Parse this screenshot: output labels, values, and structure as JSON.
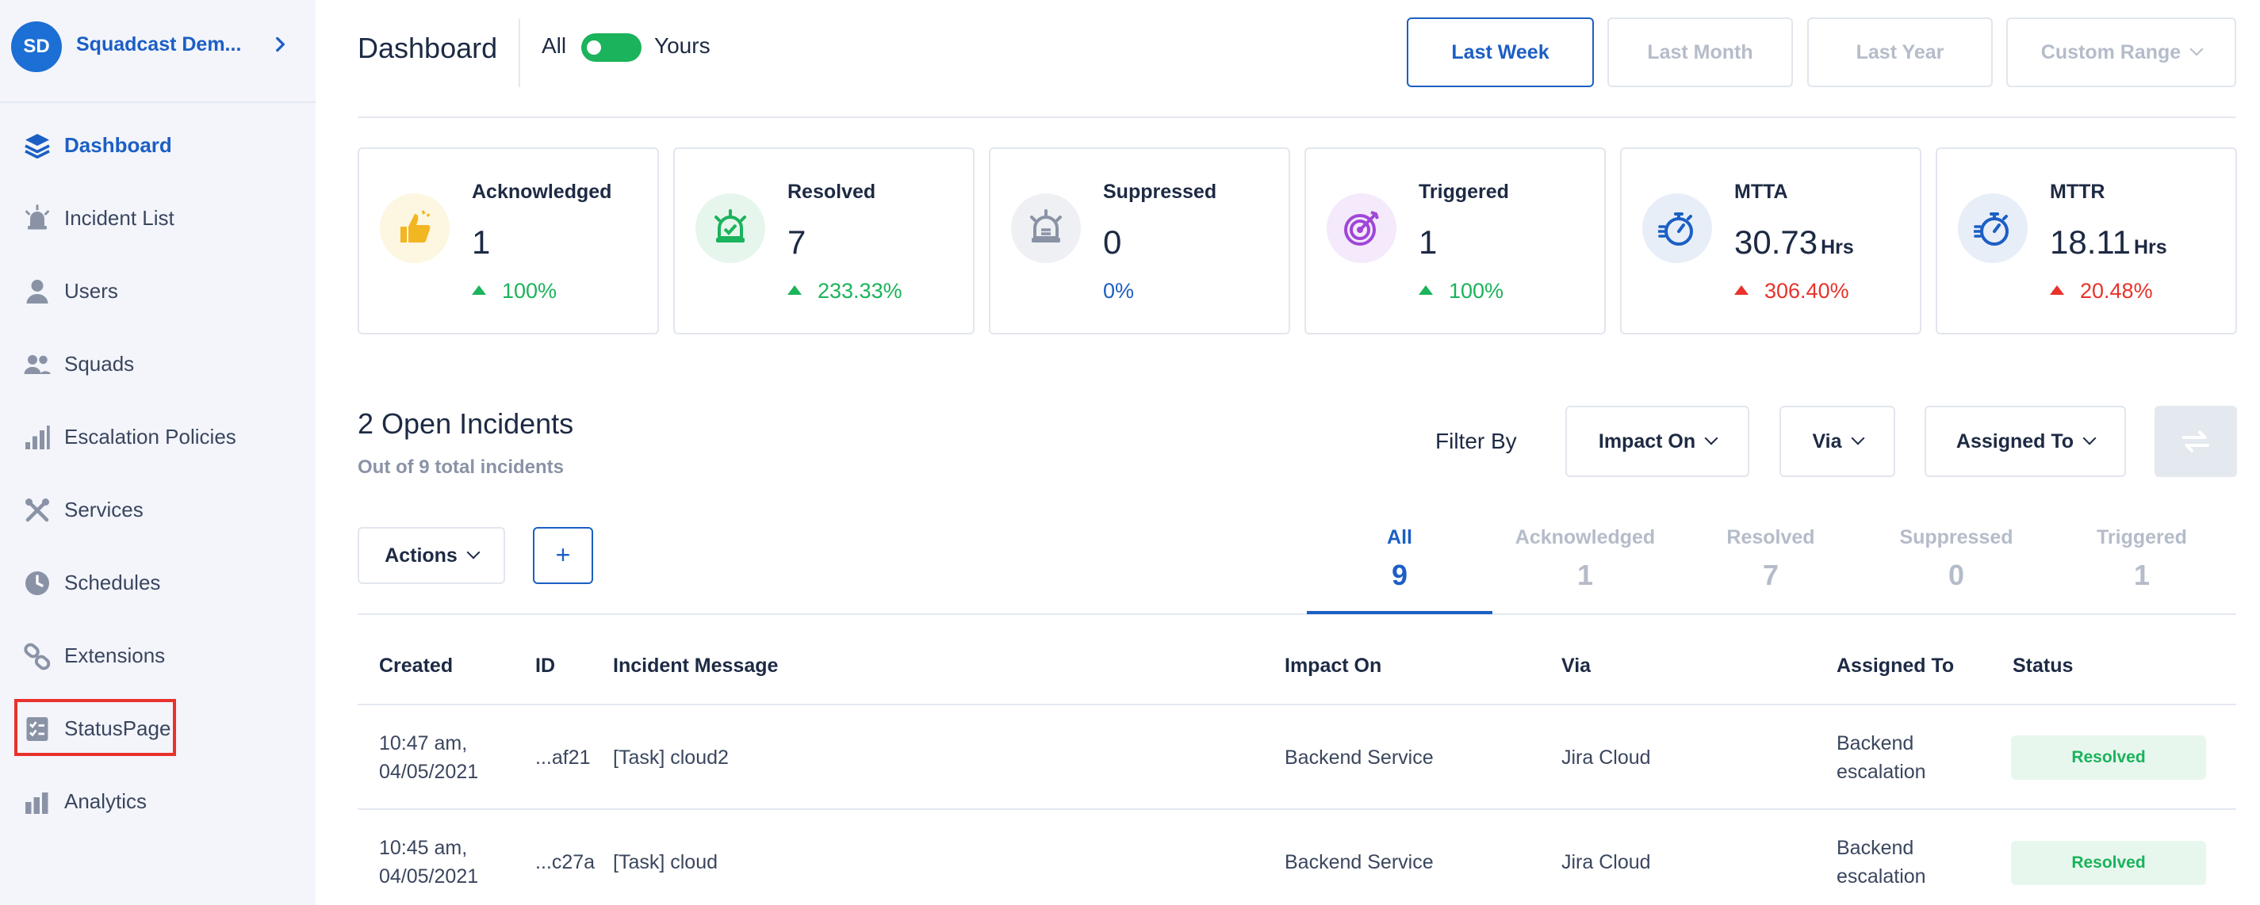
{
  "org": {
    "initials": "SD",
    "name": "Squadcast Dem..."
  },
  "sidebar": {
    "items": [
      {
        "label": "Dashboard",
        "icon": "layers-icon"
      },
      {
        "label": "Incident List",
        "icon": "siren-icon"
      },
      {
        "label": "Users",
        "icon": "user-icon"
      },
      {
        "label": "Squads",
        "icon": "users-icon"
      },
      {
        "label": "Escalation Policies",
        "icon": "bar-steps-icon"
      },
      {
        "label": "Services",
        "icon": "tools-icon"
      },
      {
        "label": "Schedules",
        "icon": "clock-icon"
      },
      {
        "label": "Extensions",
        "icon": "link-icon"
      },
      {
        "label": "StatusPage",
        "icon": "checklist-icon"
      },
      {
        "label": "Analytics",
        "icon": "bar-chart-icon"
      }
    ]
  },
  "header": {
    "title": "Dashboard",
    "scope_all": "All",
    "scope_yours": "Yours",
    "ranges": [
      "Last Week",
      "Last Month",
      "Last Year",
      "Custom Range"
    ]
  },
  "stats": [
    {
      "title": "Acknowledged",
      "value": "1",
      "unit": "",
      "change": "100%",
      "trend": "up-good",
      "icon": "thumbs-up-icon",
      "icon_color": "#f2b620",
      "icon_bg": "#fdf6e0"
    },
    {
      "title": "Resolved",
      "value": "7",
      "unit": "",
      "change": "233.33%",
      "trend": "up-good",
      "icon": "siren-check-icon",
      "icon_color": "#1bb35b",
      "icon_bg": "#e6f6ec"
    },
    {
      "title": "Suppressed",
      "value": "0",
      "unit": "",
      "change": "0%",
      "trend": "neutral",
      "icon": "siren-muted-icon",
      "icon_color": "#8a93a6",
      "icon_bg": "#eef0f4"
    },
    {
      "title": "Triggered",
      "value": "1",
      "unit": "",
      "change": "100%",
      "trend": "up-good",
      "icon": "target-icon",
      "icon_color": "#a046d8",
      "icon_bg": "#f4eafb"
    },
    {
      "title": "MTTA",
      "value": "30.73",
      "unit": "Hrs",
      "change": "306.40%",
      "trend": "up-bad",
      "icon": "stopwatch-icon",
      "icon_color": "#1c5fc4",
      "icon_bg": "#e8eef8"
    },
    {
      "title": "MTTR",
      "value": "18.11",
      "unit": "Hrs",
      "change": "20.48%",
      "trend": "up-bad",
      "icon": "stopwatch-icon",
      "icon_color": "#1c5fc4",
      "icon_bg": "#e8eef8"
    }
  ],
  "incidents": {
    "title": "2 Open Incidents",
    "subtitle": "Out of 9 total incidents",
    "filter_label": "Filter By",
    "filters": [
      "Impact On",
      "Via",
      "Assigned To"
    ],
    "actions_label": "Actions",
    "add_label": "+",
    "tabs": [
      {
        "label": "All",
        "count": "9"
      },
      {
        "label": "Acknowledged",
        "count": "1"
      },
      {
        "label": "Resolved",
        "count": "7"
      },
      {
        "label": "Suppressed",
        "count": "0"
      },
      {
        "label": "Triggered",
        "count": "1"
      }
    ],
    "columns": [
      "Created",
      "ID",
      "Incident Message",
      "Impact On",
      "Via",
      "Assigned To",
      "Status"
    ],
    "rows": [
      {
        "created_time": "10:47 am,",
        "created_date": "04/05/2021",
        "id": "...af21",
        "message": "[Task] cloud2",
        "impact": "Backend Service",
        "via": "Jira Cloud",
        "assigned_1": "Backend",
        "assigned_2": "escalation",
        "status": "Resolved"
      },
      {
        "created_time": "10:45 am,",
        "created_date": "04/05/2021",
        "id": "...c27a",
        "message": "[Task] cloud",
        "impact": "Backend Service",
        "via": "Jira Cloud",
        "assigned_1": "Backend",
        "assigned_2": "escalation",
        "status": "Resolved"
      }
    ]
  }
}
